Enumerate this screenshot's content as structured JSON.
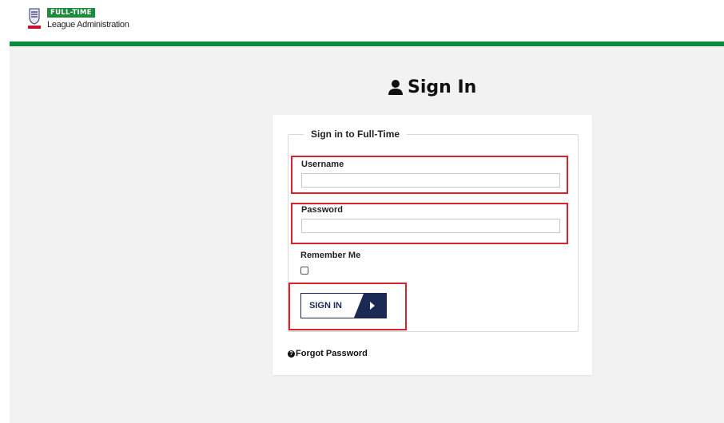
{
  "header": {
    "crest_icon": "fa-crest-icon",
    "brand_badge": "FULL-TIME",
    "brand_subtitle": "League Administration",
    "brand_color": "#0b8a3e"
  },
  "page": {
    "title": "Sign In",
    "title_icon": "user-icon"
  },
  "form": {
    "legend": "Sign in to Full-Time",
    "username": {
      "label": "Username",
      "value": "",
      "placeholder": ""
    },
    "password": {
      "label": "Password",
      "value": "",
      "placeholder": ""
    },
    "remember": {
      "label": "Remember Me",
      "checked": false
    },
    "submit_label": "SIGN IN",
    "submit_icon": "play-arrow-icon"
  },
  "links": {
    "forgot_password": "Forgot Password",
    "forgot_icon": "question-circle-icon"
  },
  "annotations": {
    "highlight_color": "#d7232b"
  }
}
